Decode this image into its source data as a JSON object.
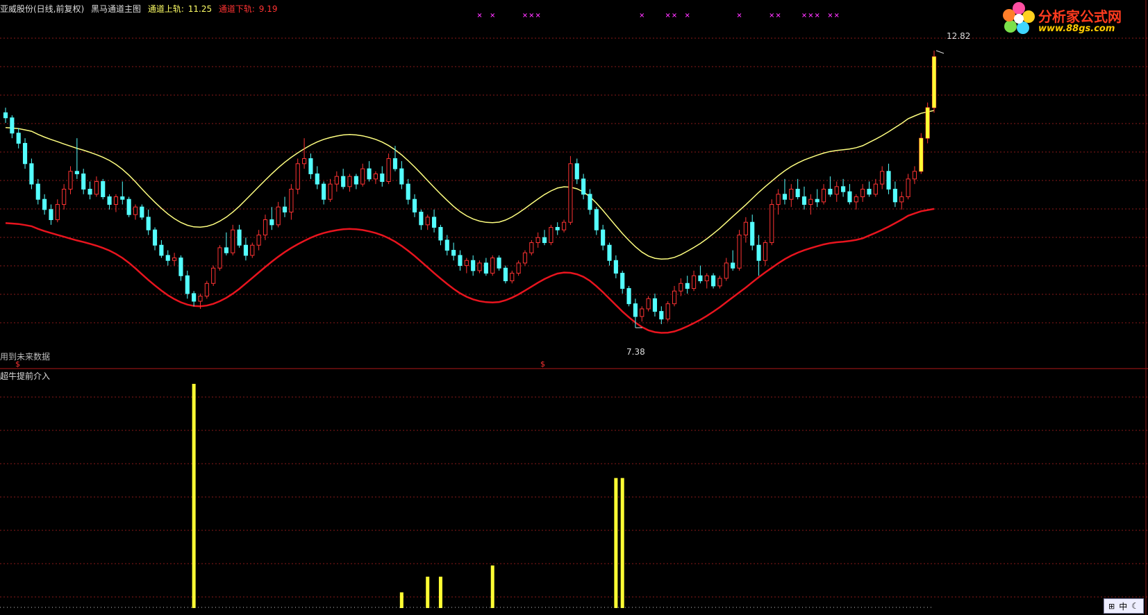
{
  "header": {
    "stock": "亚威股份(日线,前复权)",
    "indicator": "黑马通道主图",
    "upper_label": "通道上轨:",
    "upper_value": "11.25",
    "lower_label": "通道下轨:",
    "lower_value": "9.19"
  },
  "logo": {
    "text": "分析家公式网",
    "url": "www.88gs.com"
  },
  "labels": {
    "future_data": "用到未来数据",
    "sub_title": "超牛提前介入",
    "high_marker": "12.82",
    "low_marker": "7.38",
    "signal_mark": "$"
  },
  "ime": {
    "text": "中"
  },
  "colors": {
    "background": "#000000",
    "up_candle": "#ff3333",
    "down_candle": "#54ffff",
    "upper_band": "#ffff80",
    "lower_band": "#e8141e",
    "signal_bar": "#ffff33",
    "grid": "#8a1a1a",
    "header_upper": "#ffff66",
    "header_lower": "#ff3333",
    "marker_x": "#ff33ff"
  },
  "chart_data": [
    {
      "type": "candlestick",
      "title": "亚威股份(日线,前复权) 黑马通道主图",
      "series": [
        {
          "name": "通道上轨",
          "last": 11.25
        },
        {
          "name": "通道下轨",
          "last": 9.19
        }
      ],
      "ylim": [
        7.0,
        13.2
      ],
      "annotations": [
        {
          "text": "12.82",
          "value": 12.82
        },
        {
          "text": "7.38",
          "value": 7.38
        }
      ],
      "candles": [
        [
          11.6,
          11.7,
          11.4,
          11.5
        ],
        [
          11.5,
          11.55,
          11.1,
          11.2
        ],
        [
          11.2,
          11.3,
          10.9,
          11.0
        ],
        [
          11.0,
          11.1,
          10.5,
          10.6
        ],
        [
          10.6,
          10.7,
          10.1,
          10.2
        ],
        [
          10.2,
          10.3,
          9.8,
          9.9
        ],
        [
          9.9,
          10.0,
          9.6,
          9.7
        ],
        [
          9.7,
          9.8,
          9.4,
          9.5
        ],
        [
          9.5,
          9.9,
          9.45,
          9.8
        ],
        [
          9.8,
          10.2,
          9.7,
          10.1
        ],
        [
          10.1,
          10.55,
          10.0,
          10.45
        ],
        [
          10.45,
          11.1,
          10.3,
          10.4
        ],
        [
          10.4,
          10.5,
          10.0,
          10.1
        ],
        [
          10.1,
          10.25,
          9.9,
          10.0
        ],
        [
          10.0,
          10.35,
          9.95,
          10.25
        ],
        [
          10.25,
          10.3,
          9.9,
          9.95
        ],
        [
          9.95,
          10.0,
          9.7,
          9.8
        ],
        [
          9.8,
          10.0,
          9.65,
          9.95
        ],
        [
          9.95,
          10.25,
          9.8,
          9.9
        ],
        [
          9.9,
          9.95,
          9.55,
          9.6
        ],
        [
          9.6,
          9.8,
          9.5,
          9.75
        ],
        [
          9.75,
          9.8,
          9.5,
          9.55
        ],
        [
          9.55,
          9.7,
          9.2,
          9.3
        ],
        [
          9.3,
          9.35,
          8.9,
          9.0
        ],
        [
          9.0,
          9.1,
          8.75,
          8.8
        ],
        [
          8.8,
          8.9,
          8.6,
          8.7
        ],
        [
          8.7,
          8.85,
          8.6,
          8.75
        ],
        [
          8.75,
          8.8,
          8.3,
          8.4
        ],
        [
          8.4,
          8.5,
          7.95,
          8.05
        ],
        [
          8.05,
          8.1,
          7.8,
          7.9
        ],
        [
          7.9,
          8.05,
          7.75,
          8.0
        ],
        [
          8.0,
          8.3,
          7.95,
          8.25
        ],
        [
          8.25,
          8.6,
          8.2,
          8.55
        ],
        [
          8.55,
          9.0,
          8.5,
          8.95
        ],
        [
          8.95,
          9.25,
          8.8,
          8.85
        ],
        [
          8.85,
          9.4,
          8.8,
          9.3
        ],
        [
          9.3,
          9.4,
          8.95,
          9.0
        ],
        [
          9.0,
          9.15,
          8.7,
          8.8
        ],
        [
          8.8,
          9.05,
          8.75,
          9.0
        ],
        [
          9.0,
          9.3,
          8.9,
          9.2
        ],
        [
          9.2,
          9.6,
          9.1,
          9.5
        ],
        [
          9.5,
          9.75,
          9.3,
          9.4
        ],
        [
          9.4,
          9.85,
          9.35,
          9.75
        ],
        [
          9.75,
          9.95,
          9.55,
          9.65
        ],
        [
          9.65,
          10.2,
          9.5,
          10.1
        ],
        [
          10.1,
          10.7,
          10.0,
          10.6
        ],
        [
          10.6,
          11.1,
          10.5,
          10.7
        ],
        [
          10.7,
          10.8,
          10.3,
          10.4
        ],
        [
          10.4,
          10.55,
          10.1,
          10.2
        ],
        [
          10.2,
          10.25,
          9.8,
          9.9
        ],
        [
          9.9,
          10.3,
          9.85,
          10.2
        ],
        [
          10.2,
          10.45,
          10.05,
          10.35
        ],
        [
          10.35,
          10.5,
          10.1,
          10.15
        ],
        [
          10.15,
          10.4,
          10.05,
          10.35
        ],
        [
          10.35,
          10.4,
          10.1,
          10.2
        ],
        [
          10.2,
          10.6,
          10.15,
          10.5
        ],
        [
          10.5,
          10.65,
          10.25,
          10.3
        ],
        [
          10.3,
          10.45,
          10.2,
          10.4
        ],
        [
          10.4,
          10.55,
          10.15,
          10.25
        ],
        [
          10.25,
          10.8,
          10.2,
          10.7
        ],
        [
          10.7,
          10.95,
          10.45,
          10.5
        ],
        [
          10.5,
          10.65,
          10.1,
          10.2
        ],
        [
          10.2,
          10.3,
          9.8,
          9.9
        ],
        [
          9.9,
          10.0,
          9.55,
          9.65
        ],
        [
          9.65,
          9.7,
          9.3,
          9.4
        ],
        [
          9.4,
          9.6,
          9.3,
          9.55
        ],
        [
          9.55,
          9.7,
          9.25,
          9.35
        ],
        [
          9.35,
          9.4,
          9.0,
          9.1
        ],
        [
          9.1,
          9.2,
          8.8,
          8.9
        ],
        [
          8.9,
          9.05,
          8.7,
          8.8
        ],
        [
          8.8,
          8.9,
          8.5,
          8.6
        ],
        [
          8.6,
          8.75,
          8.45,
          8.7
        ],
        [
          8.7,
          8.8,
          8.4,
          8.5
        ],
        [
          8.5,
          8.7,
          8.45,
          8.65
        ],
        [
          8.65,
          8.75,
          8.4,
          8.45
        ],
        [
          8.45,
          8.8,
          8.4,
          8.75
        ],
        [
          8.75,
          8.8,
          8.5,
          8.55
        ],
        [
          8.55,
          8.6,
          8.25,
          8.3
        ],
        [
          8.3,
          8.5,
          8.25,
          8.45
        ],
        [
          8.45,
          8.7,
          8.4,
          8.65
        ],
        [
          8.65,
          8.9,
          8.6,
          8.85
        ],
        [
          8.85,
          9.1,
          8.8,
          9.05
        ],
        [
          9.05,
          9.25,
          8.95,
          9.15
        ],
        [
          9.15,
          9.3,
          9.0,
          9.05
        ],
        [
          9.05,
          9.4,
          9.0,
          9.35
        ],
        [
          9.35,
          9.45,
          9.2,
          9.3
        ],
        [
          9.3,
          9.5,
          9.25,
          9.45
        ],
        [
          9.45,
          10.75,
          9.4,
          10.6
        ],
        [
          10.6,
          10.7,
          10.2,
          10.3
        ],
        [
          10.3,
          10.4,
          9.9,
          10.0
        ],
        [
          10.0,
          10.1,
          9.6,
          9.7
        ],
        [
          9.7,
          9.75,
          9.2,
          9.3
        ],
        [
          9.3,
          9.4,
          8.9,
          9.0
        ],
        [
          9.0,
          9.05,
          8.6,
          8.7
        ],
        [
          8.7,
          8.8,
          8.35,
          8.45
        ],
        [
          8.45,
          8.5,
          8.05,
          8.15
        ],
        [
          8.15,
          8.2,
          7.8,
          7.85
        ],
        [
          7.85,
          7.95,
          7.38,
          7.6
        ],
        [
          7.6,
          7.8,
          7.5,
          7.75
        ],
        [
          7.75,
          8.0,
          7.7,
          7.95
        ],
        [
          7.95,
          8.05,
          7.6,
          7.7
        ],
        [
          7.7,
          7.8,
          7.45,
          7.55
        ],
        [
          7.55,
          7.9,
          7.5,
          7.85
        ],
        [
          7.85,
          8.2,
          7.8,
          8.1
        ],
        [
          8.1,
          8.35,
          8.0,
          8.25
        ],
        [
          8.25,
          8.4,
          8.05,
          8.15
        ],
        [
          8.15,
          8.5,
          8.1,
          8.4
        ],
        [
          8.4,
          8.6,
          8.25,
          8.3
        ],
        [
          8.3,
          8.45,
          8.15,
          8.4
        ],
        [
          8.4,
          8.45,
          8.15,
          8.2
        ],
        [
          8.2,
          8.4,
          8.15,
          8.35
        ],
        [
          8.35,
          8.75,
          8.3,
          8.65
        ],
        [
          8.65,
          8.9,
          8.5,
          8.55
        ],
        [
          8.55,
          9.3,
          8.5,
          9.2
        ],
        [
          9.2,
          9.55,
          9.05,
          9.45
        ],
        [
          9.45,
          9.6,
          8.9,
          9.0
        ],
        [
          9.0,
          9.2,
          8.4,
          8.7
        ],
        [
          8.7,
          9.1,
          8.6,
          9.05
        ],
        [
          9.05,
          9.9,
          9.0,
          9.8
        ],
        [
          9.8,
          10.1,
          9.6,
          10.0
        ],
        [
          10.0,
          10.3,
          9.8,
          9.9
        ],
        [
          9.9,
          10.2,
          9.75,
          10.1
        ],
        [
          10.1,
          10.3,
          9.9,
          9.95
        ],
        [
          9.95,
          10.15,
          9.7,
          9.8
        ],
        [
          9.8,
          10.0,
          9.6,
          9.9
        ],
        [
          9.9,
          10.1,
          9.75,
          9.85
        ],
        [
          9.85,
          10.2,
          9.8,
          10.1
        ],
        [
          10.1,
          10.35,
          9.95,
          10.0
        ],
        [
          10.0,
          10.25,
          9.85,
          10.15
        ],
        [
          10.15,
          10.3,
          9.95,
          10.05
        ],
        [
          10.05,
          10.2,
          9.8,
          9.85
        ],
        [
          9.85,
          10.0,
          9.7,
          9.95
        ],
        [
          9.95,
          10.2,
          9.85,
          10.1
        ],
        [
          10.1,
          10.25,
          9.95,
          10.0
        ],
        [
          10.0,
          10.3,
          9.95,
          10.2
        ],
        [
          10.2,
          10.55,
          10.1,
          10.45
        ],
        [
          10.45,
          10.6,
          10.0,
          10.1
        ],
        [
          10.1,
          10.25,
          9.75,
          9.85
        ],
        [
          9.85,
          10.05,
          9.7,
          9.95
        ],
        [
          9.95,
          10.4,
          9.9,
          10.3
        ],
        [
          10.3,
          10.55,
          10.2,
          10.45
        ],
        [
          10.45,
          11.2,
          10.4,
          11.1
        ],
        [
          11.1,
          11.8,
          11.0,
          11.7
        ],
        [
          11.7,
          12.82,
          11.6,
          12.7
        ]
      ]
    },
    {
      "type": "bar",
      "title": "超牛提前介入",
      "values": [
        {
          "index": 29,
          "value": 1.0
        },
        {
          "index": 61,
          "value": 0.07
        },
        {
          "index": 65,
          "value": 0.14
        },
        {
          "index": 67,
          "value": 0.14
        },
        {
          "index": 75,
          "value": 0.19
        },
        {
          "index": 94,
          "value": 0.58
        },
        {
          "index": 95,
          "value": 0.58
        }
      ]
    }
  ]
}
